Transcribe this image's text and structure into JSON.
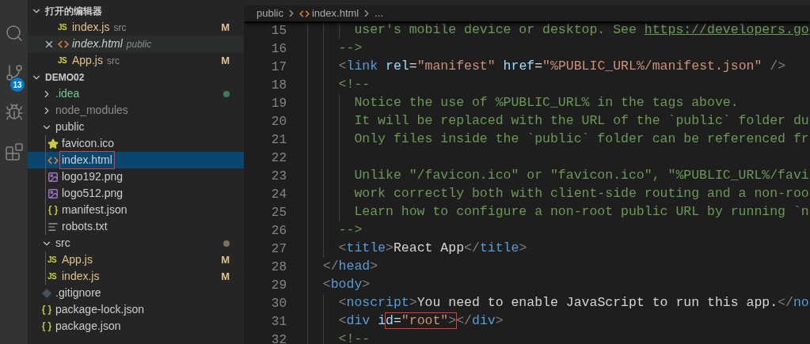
{
  "activity_bar": {
    "items": [
      {
        "kind": "search"
      },
      {
        "kind": "scm",
        "badge": "13"
      },
      {
        "kind": "debug"
      },
      {
        "kind": "extensions"
      }
    ]
  },
  "open_editors": {
    "title": "打开的编辑器",
    "expanded": true,
    "items": [
      {
        "kind": "js",
        "glyph": "JS",
        "name": "index.js",
        "folder": "src",
        "badge": "M",
        "modified": true,
        "preview": false,
        "hovered": false
      },
      {
        "kind": "html",
        "name": "index.html",
        "folder": "public",
        "modified": false,
        "preview": true,
        "hovered": true
      },
      {
        "kind": "js",
        "glyph": "JS",
        "name": "App.js",
        "folder": "src",
        "badge": "M",
        "modified": true,
        "preview": false,
        "hovered": false
      }
    ]
  },
  "explorer": {
    "title": "DEMO02",
    "expanded": true,
    "items": [
      {
        "kind": "folder",
        "name": ".idea",
        "expanded": false,
        "selected": false,
        "untracked": true,
        "color": "#3e7a55"
      },
      {
        "kind": "folder",
        "name": "node_modules",
        "expanded": false,
        "selected": false,
        "ignored": true
      },
      {
        "kind": "folder",
        "name": "public",
        "expanded": true,
        "selected": false,
        "children": [
          {
            "kind": "favicon",
            "name": "favicon.ico",
            "selected": false
          },
          {
            "kind": "html",
            "name": "index.html",
            "selected": true,
            "annotated": true
          },
          {
            "kind": "image",
            "name": "logo192.png",
            "selected": false
          },
          {
            "kind": "image",
            "name": "logo512.png",
            "selected": false
          },
          {
            "kind": "json",
            "name": "manifest.json",
            "selected": false
          },
          {
            "kind": "text",
            "name": "robots.txt",
            "selected": false
          }
        ]
      },
      {
        "kind": "folder",
        "name": "src",
        "expanded": true,
        "selected": false,
        "color": "#7d6e5d",
        "children": [
          {
            "kind": "js",
            "glyph": "JS",
            "name": "App.js",
            "selected": false,
            "modified": true,
            "badge": "M"
          },
          {
            "kind": "js",
            "glyph": "JS",
            "name": "index.js",
            "selected": false,
            "modified": true,
            "badge": "M"
          }
        ]
      },
      {
        "kind": "git",
        "name": ".gitignore",
        "selected": false
      },
      {
        "kind": "json",
        "name": "package-lock.json",
        "selected": false
      },
      {
        "kind": "json",
        "name": "package.json",
        "selected": false
      }
    ]
  },
  "breadcrumb": [
    {
      "kind": "folder",
      "text": "public"
    },
    {
      "kind": "html",
      "text": "index.html"
    },
    {
      "kind": "more",
      "text": "..."
    }
  ],
  "code_lines": [
    {
      "number": "15",
      "tokens": [
        {
          "kind": "comment",
          "text": "      user's mobile device or desktop. See "
        },
        {
          "kind": "link",
          "text": "https://developers.go"
        }
      ]
    },
    {
      "number": "16",
      "tokens": [
        {
          "kind": "comment",
          "text": "    -->"
        }
      ]
    },
    {
      "number": "17",
      "tokens": [
        {
          "kind": "punct",
          "text": "    <"
        },
        {
          "kind": "tag",
          "text": "link"
        },
        {
          "kind": "attr",
          "text": " rel"
        },
        {
          "kind": "plain",
          "text": "="
        },
        {
          "kind": "string",
          "text": "\"manifest\""
        },
        {
          "kind": "attr",
          "text": " href"
        },
        {
          "kind": "plain",
          "text": "="
        },
        {
          "kind": "string",
          "text": "\"%PUBLIC_URL%/manifest.json\""
        },
        {
          "kind": "punct",
          "text": " />"
        }
      ]
    },
    {
      "number": "18",
      "tokens": [
        {
          "kind": "comment",
          "text": "    <!--"
        }
      ]
    },
    {
      "number": "19",
      "tokens": [
        {
          "kind": "comment",
          "text": "      Notice the use of %PUBLIC_URL% in the tags above."
        }
      ]
    },
    {
      "number": "20",
      "tokens": [
        {
          "kind": "comment",
          "text": "      It will be replaced with the URL of the `public` folder du"
        }
      ]
    },
    {
      "number": "21",
      "tokens": [
        {
          "kind": "comment",
          "text": "      Only files inside the `public` folder can be referenced fr"
        }
      ]
    },
    {
      "number": "22"
    },
    {
      "number": "23",
      "tokens": [
        {
          "kind": "comment",
          "text": "      Unlike \"/favicon.ico\" or \"favicon.ico\", \"%PUBLIC_URL%/favi"
        }
      ]
    },
    {
      "number": "24",
      "tokens": [
        {
          "kind": "comment",
          "text": "      work correctly both with client-side routing and a non-roo"
        }
      ]
    },
    {
      "number": "25",
      "tokens": [
        {
          "kind": "comment",
          "text": "      Learn how to configure a non-root public URL by running `n"
        }
      ]
    },
    {
      "number": "26",
      "tokens": [
        {
          "kind": "comment",
          "text": "    -->"
        }
      ]
    },
    {
      "number": "27",
      "tokens": [
        {
          "kind": "punct",
          "text": "    <"
        },
        {
          "kind": "tag",
          "text": "title"
        },
        {
          "kind": "punct",
          "text": ">"
        },
        {
          "kind": "plain",
          "text": "React App"
        },
        {
          "kind": "punct",
          "text": "</"
        },
        {
          "kind": "tag",
          "text": "title"
        },
        {
          "kind": "punct",
          "text": ">"
        }
      ]
    },
    {
      "number": "28",
      "tokens": [
        {
          "kind": "punct",
          "text": "  </"
        },
        {
          "kind": "tag",
          "text": "head"
        },
        {
          "kind": "punct",
          "text": ">"
        }
      ]
    },
    {
      "number": "29",
      "tokens": [
        {
          "kind": "punct",
          "text": "  <"
        },
        {
          "kind": "tag",
          "text": "body"
        },
        {
          "kind": "punct",
          "text": ">"
        }
      ]
    },
    {
      "number": "30",
      "tokens": [
        {
          "kind": "punct",
          "text": "    <"
        },
        {
          "kind": "tag",
          "text": "noscript"
        },
        {
          "kind": "punct",
          "text": ">"
        },
        {
          "kind": "plain",
          "text": "You need to enable JavaScript to run this app."
        },
        {
          "kind": "punct",
          "text": "</"
        },
        {
          "kind": "tag",
          "text": "no"
        }
      ]
    },
    {
      "number": "31",
      "tokens": [
        {
          "kind": "punct",
          "text": "    <"
        },
        {
          "kind": "tag",
          "text": "div"
        },
        {
          "kind": "attr",
          "text": " i"
        },
        {
          "kind": "box",
          "tokens": [
            {
              "kind": "attr",
              "text": "d"
            },
            {
              "kind": "plain",
              "text": "="
            },
            {
              "kind": "string",
              "text": "\"root\""
            },
            {
              "kind": "punct",
              "text": ">"
            }
          ]
        },
        {
          "kind": "punct",
          "text": "</"
        },
        {
          "kind": "tag",
          "text": "div"
        },
        {
          "kind": "punct",
          "text": ">"
        }
      ]
    },
    {
      "number": "32",
      "tokens": [
        {
          "kind": "comment",
          "text": "    <!--"
        }
      ]
    }
  ]
}
